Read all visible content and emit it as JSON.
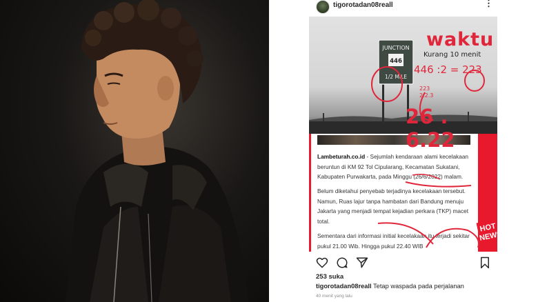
{
  "post": {
    "username": "tigorotadan08reall",
    "menu_icon": "more-dots-icon",
    "likes": "253 suka",
    "caption_user": "tigorotadan08reall",
    "caption_text": "Tetap waspada pada perjalanan",
    "time_ago": "40 menit yang lalu",
    "icons": [
      "heart-icon",
      "comment-icon",
      "share-icon",
      "bookmark-icon"
    ]
  },
  "sign": {
    "line1": "JUNCTION",
    "number": "446",
    "line2": "1/2 MILE"
  },
  "annotations": {
    "waktu": "waktu",
    "kurang": "Kurang 10 menit",
    "equation": "446 :2 = 223",
    "small1": "223",
    "small2": "2.2.3",
    "date": "26 . 6.22"
  },
  "article": {
    "p1_source": "Lambeturah.co.id",
    "p1_text": " - Sejumlah kendaraan alami kecelakaan beruntun di KM 92 Tol Cipularang, Kecamatan Sukatani, Kabupaten Purwakarta, pada Minggu (26/6/2022) malam.",
    "p2_text": "Belum diketahui penyebab terjadinya kecelakaan tersebut. Namun, Ruas lajur tanpa hambatan dari Bandung menuju Jakarta yang menjadi tempat kejadian perkara (TKP) macet total.",
    "p3_text": "Sementara dari informasi initial kecelakaan itu terjadi sekitar pukul 21.00 Wib. Hingga pukul 22.40 WIB",
    "badge": "HOT NEWS"
  },
  "colors": {
    "accent_red": "#e9192d",
    "ink": "#e0263a"
  }
}
